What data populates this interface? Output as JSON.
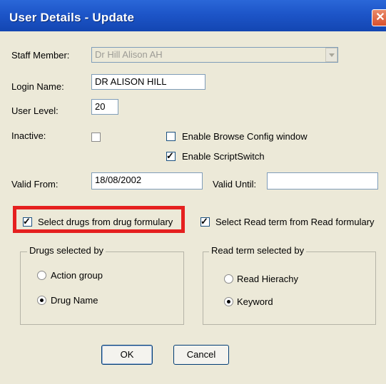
{
  "window": {
    "title": "User Details - Update"
  },
  "form": {
    "staff_member_label": "Staff Member:",
    "staff_member_value": "Dr Hill Alison AH",
    "login_name_label": "Login Name:",
    "login_name_value": "DR ALISON HILL",
    "user_level_label": "User Level:",
    "user_level_value": "20",
    "inactive_label": "Inactive:",
    "inactive_checked": false,
    "enable_browse_label": "Enable Browse Config window",
    "enable_browse_checked": false,
    "enable_scriptswitch_label": "Enable ScriptSwitch",
    "enable_scriptswitch_checked": true,
    "valid_from_label": "Valid From:",
    "valid_from_value": "18/08/2002",
    "valid_until_label": "Valid Until:",
    "valid_until_value": ""
  },
  "formulary": {
    "select_drugs_label": "Select drugs from drug formulary",
    "select_drugs_checked": true,
    "select_read_label": "Select Read term from Read formulary",
    "select_read_checked": true
  },
  "drugs_group": {
    "legend": "Drugs selected by",
    "options": [
      {
        "label": "Action group",
        "selected": false
      },
      {
        "label": "Drug Name",
        "selected": true
      }
    ]
  },
  "read_group": {
    "legend": "Read term selected by",
    "options": [
      {
        "label": "Read Hierachy",
        "selected": false
      },
      {
        "label": "Keyword",
        "selected": true
      }
    ]
  },
  "buttons": {
    "ok_label": "OK",
    "cancel_label": "Cancel"
  },
  "colors": {
    "titlebar": "#1d55c8",
    "dialog_bg": "#ece9d8",
    "highlight": "#e5201f"
  },
  "icons": {
    "close": "close-icon",
    "dropdown": "chevron-down-icon",
    "check": "check-icon"
  }
}
